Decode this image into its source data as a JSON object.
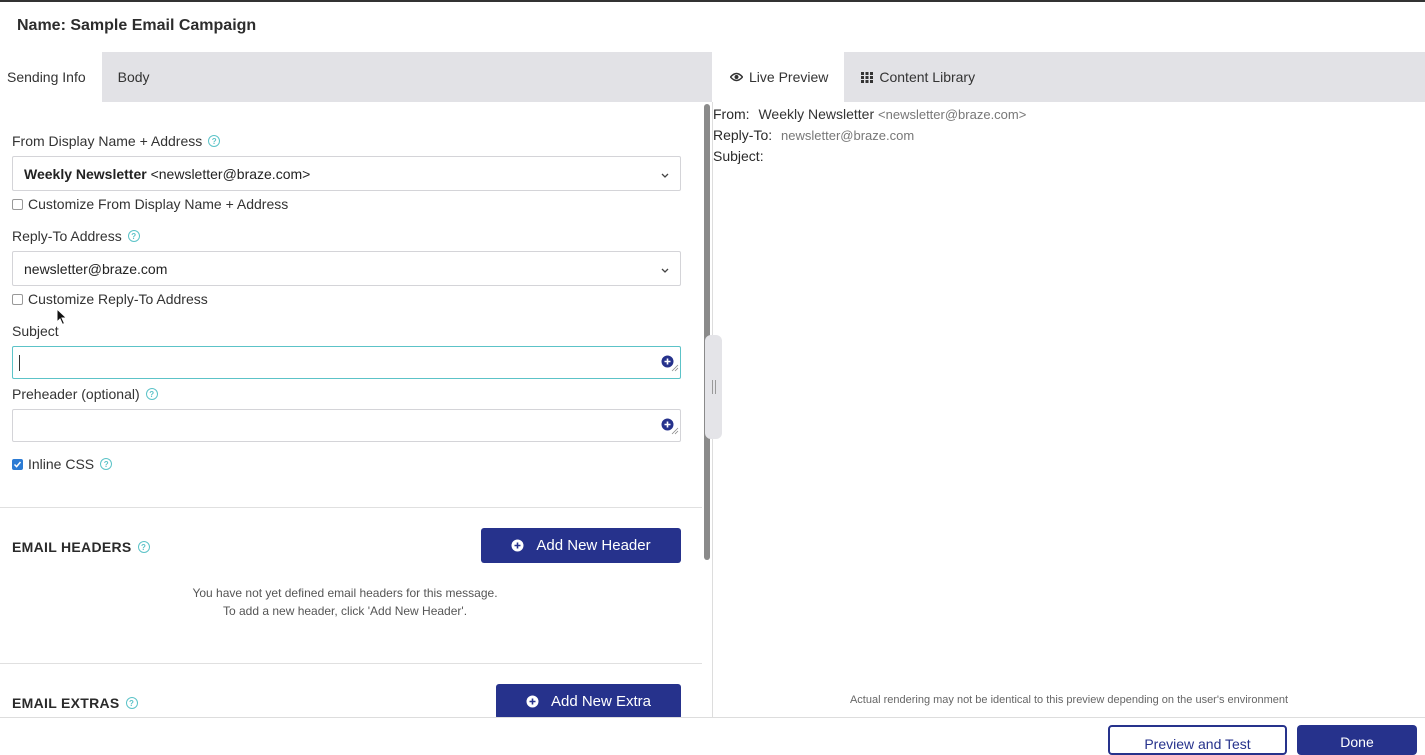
{
  "header": {
    "title": "Name: Sample Email Campaign"
  },
  "left_tabs": [
    {
      "label": "Sending Info",
      "active": true
    },
    {
      "label": "Body",
      "active": false
    }
  ],
  "right_tabs": [
    {
      "label": "Live Preview",
      "icon": "eye-icon",
      "active": false
    },
    {
      "label": "Content Library",
      "icon": "grid-icon",
      "active": false
    }
  ],
  "form": {
    "from_label": "From Display Name + Address",
    "from_value_name": "Weekly Newsletter",
    "from_value_addr": " <newsletter@braze.com>",
    "customize_from_label": "Customize From Display Name + Address",
    "reply_label": "Reply-To Address",
    "reply_value": "newsletter@braze.com",
    "customize_reply_label": "Customize Reply-To Address",
    "subject_label": "Subject",
    "subject_value": "",
    "preheader_label": "Preheader (optional)",
    "preheader_value": "",
    "inline_css_label": "Inline CSS",
    "inline_css_checked": true
  },
  "headers_section": {
    "title": "EMAIL HEADERS",
    "button_label": "Add New Header",
    "empty_line1": "You have not yet defined email headers for this message.",
    "empty_line2": "To add a new header, click 'Add New Header'."
  },
  "extras_section": {
    "title": "EMAIL EXTRAS",
    "button_label": "Add New Extra"
  },
  "preview": {
    "from_key": "From:",
    "from_name": "Weekly Newsletter",
    "from_addr": "<newsletter@braze.com>",
    "reply_key": "Reply-To:",
    "reply_value": "newsletter@braze.com",
    "subject_key": "Subject:",
    "disclaimer": "Actual rendering may not be identical to this preview depending on the user's environment"
  },
  "footer": {
    "secondary_label": "Preview and Test",
    "primary_label": "Done"
  },
  "colors": {
    "primary": "#26328c",
    "accent": "#5cc3c8",
    "checkbox": "#2b7bd4"
  }
}
